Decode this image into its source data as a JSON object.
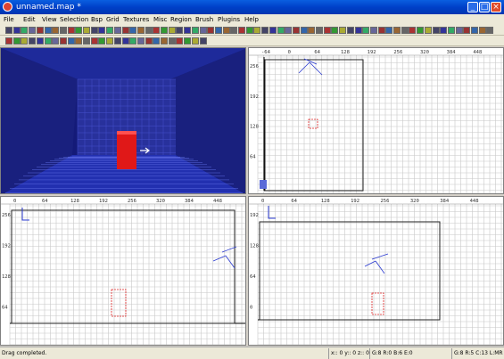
{
  "window": {
    "title": "unnamed.map *"
  },
  "menu": [
    "File",
    "Edit",
    "View",
    "Selection",
    "Bsp",
    "Grid",
    "Textures",
    "Misc",
    "Region",
    "Brush",
    "Plugins",
    "Help"
  ],
  "top_view": {
    "h_ticks": [
      "-64",
      "0",
      "64",
      "128",
      "192",
      "256",
      "320",
      "384",
      "448"
    ],
    "v_ticks": [
      "256",
      "192",
      "128",
      "64"
    ]
  },
  "front_view": {
    "h_ticks": [
      "0",
      "64",
      "128",
      "192",
      "256",
      "320",
      "384",
      "448"
    ],
    "v_ticks": [
      "256",
      "192",
      "128",
      "64"
    ]
  },
  "side_view": {
    "h_ticks": [
      "0",
      "64",
      "128",
      "192",
      "256",
      "320",
      "384",
      "448"
    ],
    "v_ticks": [
      "192",
      "128",
      "64",
      "0"
    ]
  },
  "status": {
    "message": "Drag completed.",
    "coords": "x:: 0 y:: 0 z:: 0",
    "brushes": "G:8 R:0 B:6 E:0",
    "grid": "G:8 R:5 C:13 L:MR"
  },
  "colors": {
    "grid_line": "#c8c8c8",
    "brush": "#dd2222",
    "camera": "#2a3ad0",
    "axis_green": "#2a9a2a"
  }
}
